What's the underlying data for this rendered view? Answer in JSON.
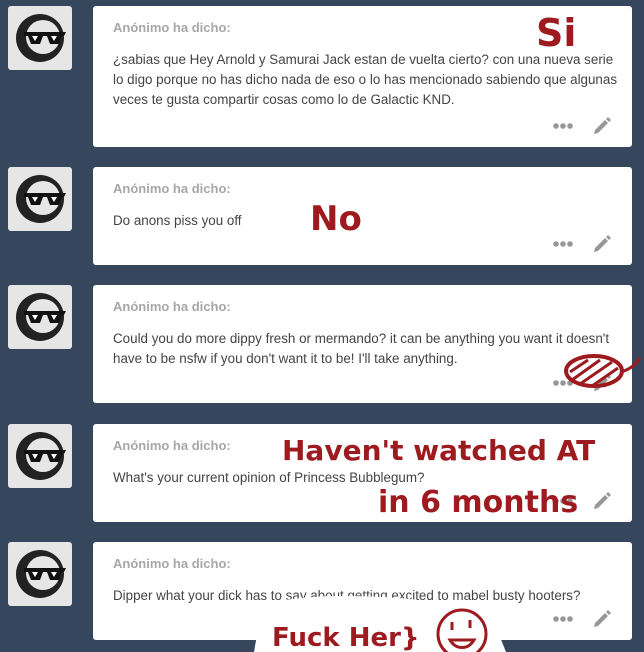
{
  "asks": [
    {
      "asker": "Anónimo ha dicho:",
      "question": "¿sabias que Hey Arnold y Samurai Jack estan de vuelta cierto? con una nueva serie lo digo porque no has dicho nada de eso o lo has mencionado sabiendo que algunas veces te gusta compartir cosas como lo de Galactic KND.",
      "answer": "Si"
    },
    {
      "asker": "Anónimo ha dicho:",
      "question": "Do anons piss you off",
      "answer": "No"
    },
    {
      "asker": "Anónimo ha dicho:",
      "question": "Could you do more dippy fresh or mermando? it can be anything you want it doesn't have to be nsfw if you don't want it to be! I'll take anything."
    },
    {
      "asker": "Anónimo ha dicho:",
      "question": "What's your current opinion of Princess Bubblegum?",
      "answer_line1": "Haven't watched AT",
      "answer_line2": "in 6 months"
    },
    {
      "asker": "Anónimo ha dicho:",
      "question": "Dipper what your dick has to say about getting excited to mabel busty hooters?",
      "answer": "Fuck Her}"
    }
  ],
  "colors": {
    "background": "#36465d",
    "card": "#ffffff",
    "asker_text": "#a7a7a7",
    "question_text": "#444444",
    "icon": "#979797",
    "handwriting": "#9d1a1f"
  },
  "icons": {
    "avatar": "sunglasses-face-icon",
    "more": "ellipsis-icon",
    "edit": "pencil-icon"
  }
}
